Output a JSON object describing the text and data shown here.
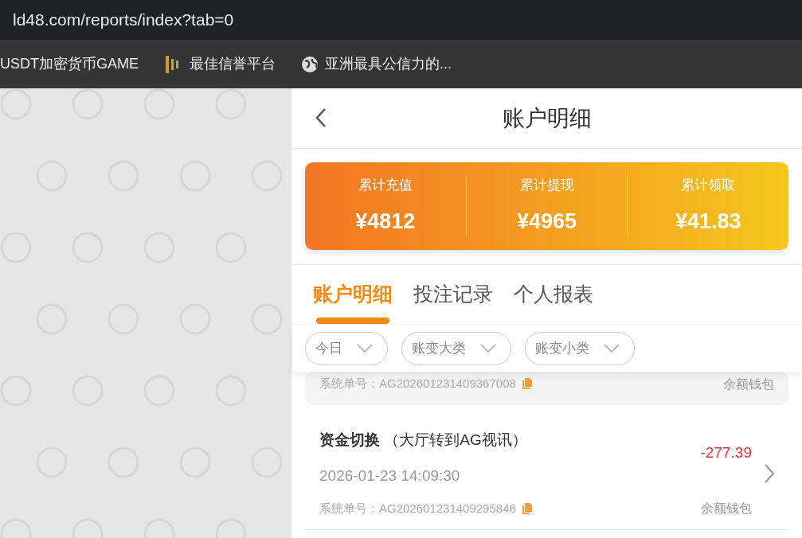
{
  "browser": {
    "url": "ld48.com/reports/index?tab=0",
    "bookmarks": [
      {
        "label": "USDT加密货币GAME",
        "kind": "plain"
      },
      {
        "label": "最佳信誉平台",
        "kind": "logo"
      },
      {
        "label": "亚洲最具公信力的...",
        "kind": "globe"
      }
    ]
  },
  "header": {
    "title": "账户明细"
  },
  "summary": [
    {
      "label": "累计充值",
      "value": "¥4812"
    },
    {
      "label": "累计提现",
      "value": "¥4965"
    },
    {
      "label": "累计领取",
      "value": "¥41.83"
    }
  ],
  "tabs": [
    {
      "label": "账户明细",
      "selected": true
    },
    {
      "label": "投注记录",
      "selected": false
    },
    {
      "label": "个人报表",
      "selected": false
    }
  ],
  "filters": [
    {
      "label": "今日"
    },
    {
      "label": "账变大类"
    },
    {
      "label": "账变小类"
    }
  ],
  "transactions": [
    {
      "selected": true,
      "order_no": "系统单号：AG202601231409367008",
      "wallet": "余额钱包"
    },
    {
      "selected": false,
      "title": "资金切换",
      "subtitle": "（大厅转到AG视讯）",
      "date": "2026-01-23 14:09:30",
      "order_no": "系统单号：AG202601231409295846",
      "amount": "-277.39",
      "wallet": "余额钱包"
    }
  ]
}
